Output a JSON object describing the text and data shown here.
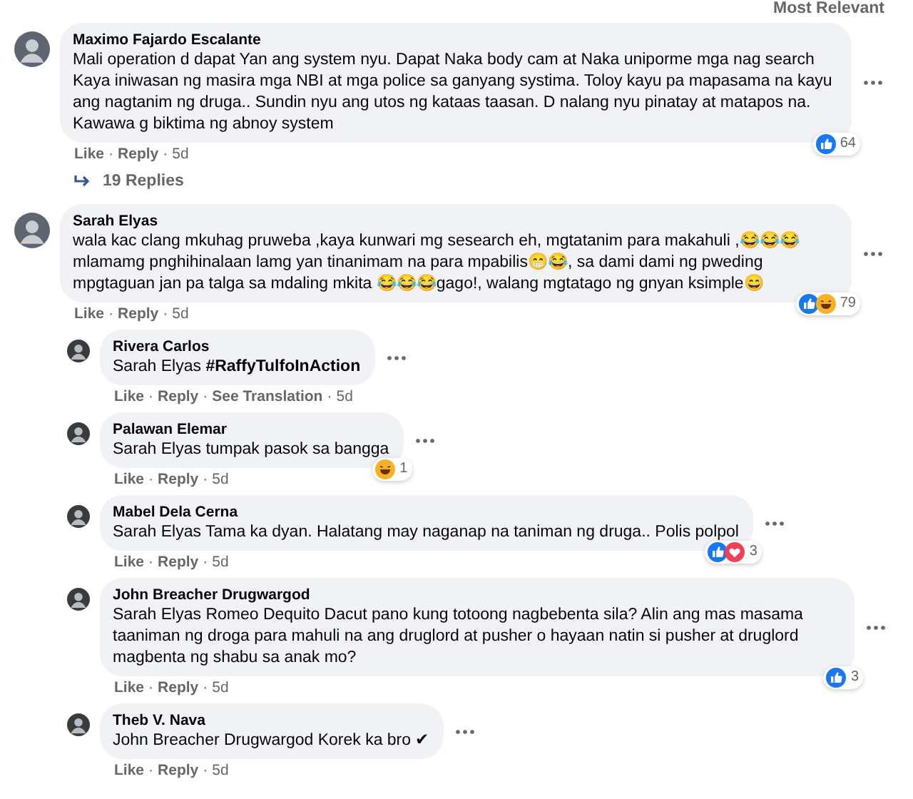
{
  "sort_label": "Most Relevant",
  "separator": "·",
  "comments": [
    {
      "author": "Maximo Fajardo Escalante",
      "text": "Mali operation d dapat Yan ang system nyu. Dapat Naka body cam at Naka uniporme mga nag search Kaya iniwasan ng masira mga NBI at mga police sa ganyang systima. Toloy kayu pa mapasama na kayu ang nagtanim ng druga.. Sundin nyu ang utos ng kataas taasan. D nalang nyu pinatay at matapos na. Kawawa g biktima ng abnoy system",
      "actions": [
        "Like",
        "Reply"
      ],
      "time": "5d",
      "reactions": {
        "icons": [
          {
            "kind": "like"
          }
        ],
        "count": "64"
      },
      "replies_link": "19 Replies"
    },
    {
      "author": "Sarah Elyas",
      "text": "wala kac clang mkuhag pruweba ,kaya kunwari mg sesearch eh, mgtatanim para makahuli ,😂😂😂 mlamamg pnghihinalaan lamg yan tinanimam na para mpabilis😁😂, sa dami dami ng pweding mpgtaguan jan pa talga sa mdaling mkita 😂😂😂gago!, walang mgtatago ng gnyan ksimple😄",
      "actions": [
        "Like",
        "Reply"
      ],
      "time": "5d",
      "reactions": {
        "icons": [
          {
            "kind": "like"
          },
          {
            "kind": "haha"
          }
        ],
        "count": "79"
      },
      "replies": [
        {
          "author": "Rivera Carlos",
          "text": "Sarah Elyas **#RaffyTulfoInAction**",
          "actions": [
            "Like",
            "Reply",
            "See Translation"
          ],
          "time": "5d"
        },
        {
          "author": "Palawan Elemar",
          "text": "Sarah Elyas tumpak pasok sa bangga",
          "actions": [
            "Like",
            "Reply"
          ],
          "time": "5d",
          "reactions": {
            "icons": [
              {
                "kind": "haha"
              }
            ],
            "count": "1"
          }
        },
        {
          "author": "Mabel Dela Cerna",
          "text": "Sarah Elyas Tama ka dyan. Halatang may naganap na taniman ng druga.. Polis polpol",
          "actions": [
            "Like",
            "Reply"
          ],
          "time": "5d",
          "reactions": {
            "icons": [
              {
                "kind": "like"
              },
              {
                "kind": "love"
              }
            ],
            "count": "3"
          }
        },
        {
          "author": "John Breacher Drugwargod",
          "text": "Sarah Elyas Romeo Dequito Dacut pano kung totoong nagbebenta sila? Alin ang mas masama taaniman ng droga para mahuli na ang druglord at pusher o hayaan natin si pusher at druglord magbenta ng shabu sa anak mo?",
          "actions": [
            "Like",
            "Reply"
          ],
          "time": "5d",
          "reactions": {
            "icons": [
              {
                "kind": "like"
              }
            ],
            "count": "3"
          }
        },
        {
          "author": "Theb V. Nava",
          "text": "John Breacher Drugwargod Korek ka bro ✔",
          "actions": [
            "Like",
            "Reply"
          ],
          "time": "5d"
        }
      ]
    }
  ]
}
